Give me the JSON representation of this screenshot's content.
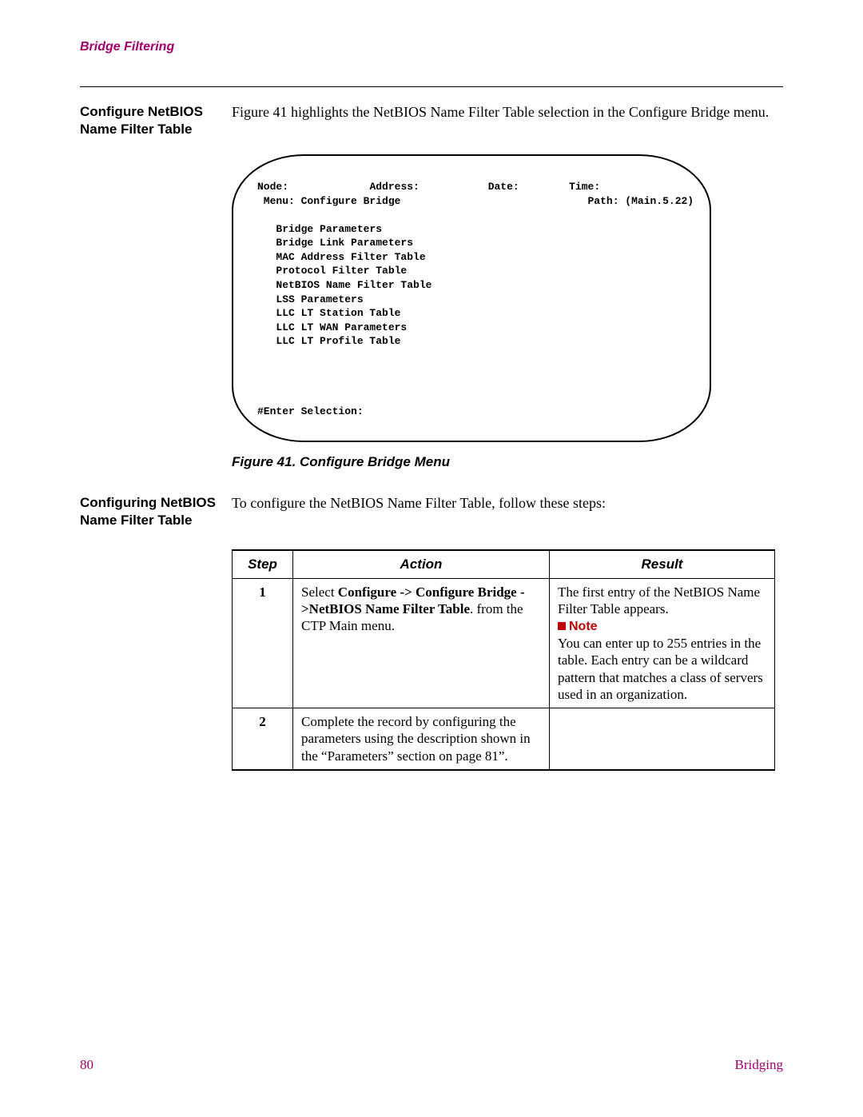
{
  "header": {
    "running_head": "Bridge Filtering"
  },
  "section1": {
    "sidehead": "Configure NetBIOS Name Filter Table",
    "body": "Figure 41 highlights the NetBIOS Name Filter Table selection in the Configure Bridge menu."
  },
  "terminal": {
    "line1_node": "Node:",
    "line1_addr": "Address:",
    "line1_date": "Date:",
    "line1_time": "Time:",
    "line2_menu": " Menu: Configure Bridge",
    "line2_path": "Path: (Main.5.22)",
    "items": [
      "Bridge Parameters",
      "Bridge Link Parameters",
      "MAC Address Filter Table",
      "Protocol Filter Table",
      "NetBIOS Name Filter Table",
      "LSS Parameters",
      "LLC LT Station Table",
      "LLC LT WAN Parameters",
      "LLC LT Profile Table"
    ],
    "prompt": "#Enter Selection:"
  },
  "fig_caption": "Figure 41. Configure Bridge Menu",
  "section2": {
    "sidehead": "Configuring NetBIOS Name Filter Table",
    "body": "To configure the NetBIOS Name Filter Table, follow these steps:"
  },
  "table": {
    "headers": {
      "step": "Step",
      "action": "Action",
      "result": "Result"
    },
    "rows": [
      {
        "step": "1",
        "action_pre": "Select ",
        "action_bold": "Configure -> Configure Bridge ->NetBIOS Name Filter Table",
        "action_post": ". from the CTP Main menu.",
        "result_pre": "The first entry of the NetBIOS Name Filter Table appears.",
        "note_label": "Note",
        "result_note": "You can enter up to 255 entries in the table. Each entry can be a wildcard pattern that matches a class of servers used in an organization."
      },
      {
        "step": "2",
        "action_plain": "Complete the record by configuring the parameters using the description shown in the “Parameters” section on page 81”.",
        "result_plain": ""
      }
    ]
  },
  "footer": {
    "page": "80",
    "section": "Bridging"
  }
}
